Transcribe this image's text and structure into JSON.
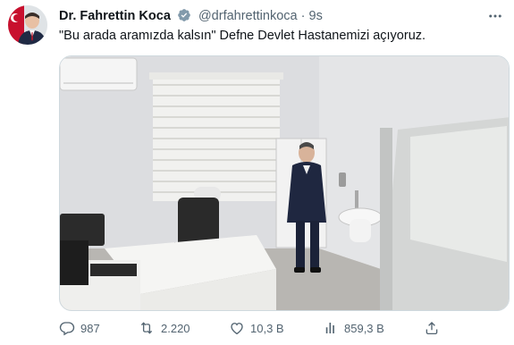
{
  "tweet": {
    "author_name": "Dr. Fahrettin Koca",
    "handle": "@drfahrettinkoca",
    "separator": "·",
    "time": "9s",
    "text": "\"Bu arada aramızda kalsın\" Defne Devlet Hastanemizi açıyoruz."
  },
  "actions": {
    "replies": "987",
    "retweets": "2.220",
    "likes": "10,3 B",
    "views": "859,3 B"
  },
  "icons": {
    "verified": "verified-badge-icon",
    "more": "more-icon",
    "reply": "reply-icon",
    "retweet": "retweet-icon",
    "like": "heart-icon",
    "views": "views-icon",
    "share": "share-icon"
  },
  "colors": {
    "text_primary": "#0f1419",
    "text_secondary": "#536471",
    "verified": "#829aab"
  }
}
